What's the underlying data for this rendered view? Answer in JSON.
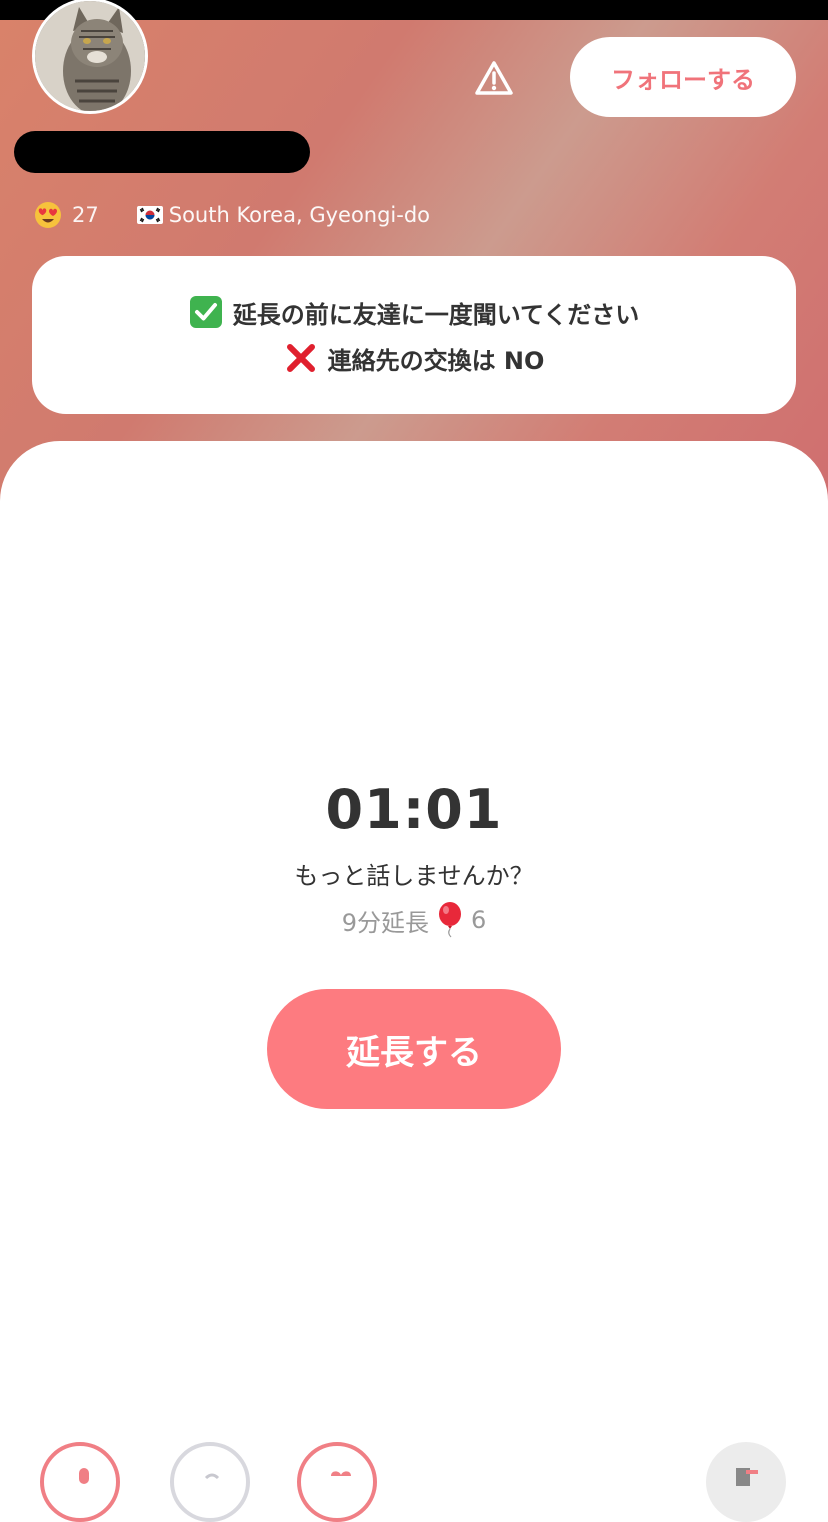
{
  "header": {
    "follow_label": "フォローする",
    "likes_count": "27",
    "location": "South Korea, Gyeongi-do",
    "flag": "south-korea-flag-icon",
    "face_emoji": "heart-eyes-emoji-icon"
  },
  "rules": {
    "line1": "延長の前に友達に一度聞いてください",
    "line2": "連絡先の交換は NO"
  },
  "call": {
    "timer": "01:01",
    "prompt": "もっと話しませんか？",
    "cost_prefix": "9分延長",
    "cost_amount": "6",
    "extend_label": "延長する"
  },
  "colors": {
    "accent": "#fd7b80",
    "follow_text": "#f0737a",
    "header_gradient_start": "#d9826a",
    "header_gradient_end": "#cf6e6f"
  }
}
